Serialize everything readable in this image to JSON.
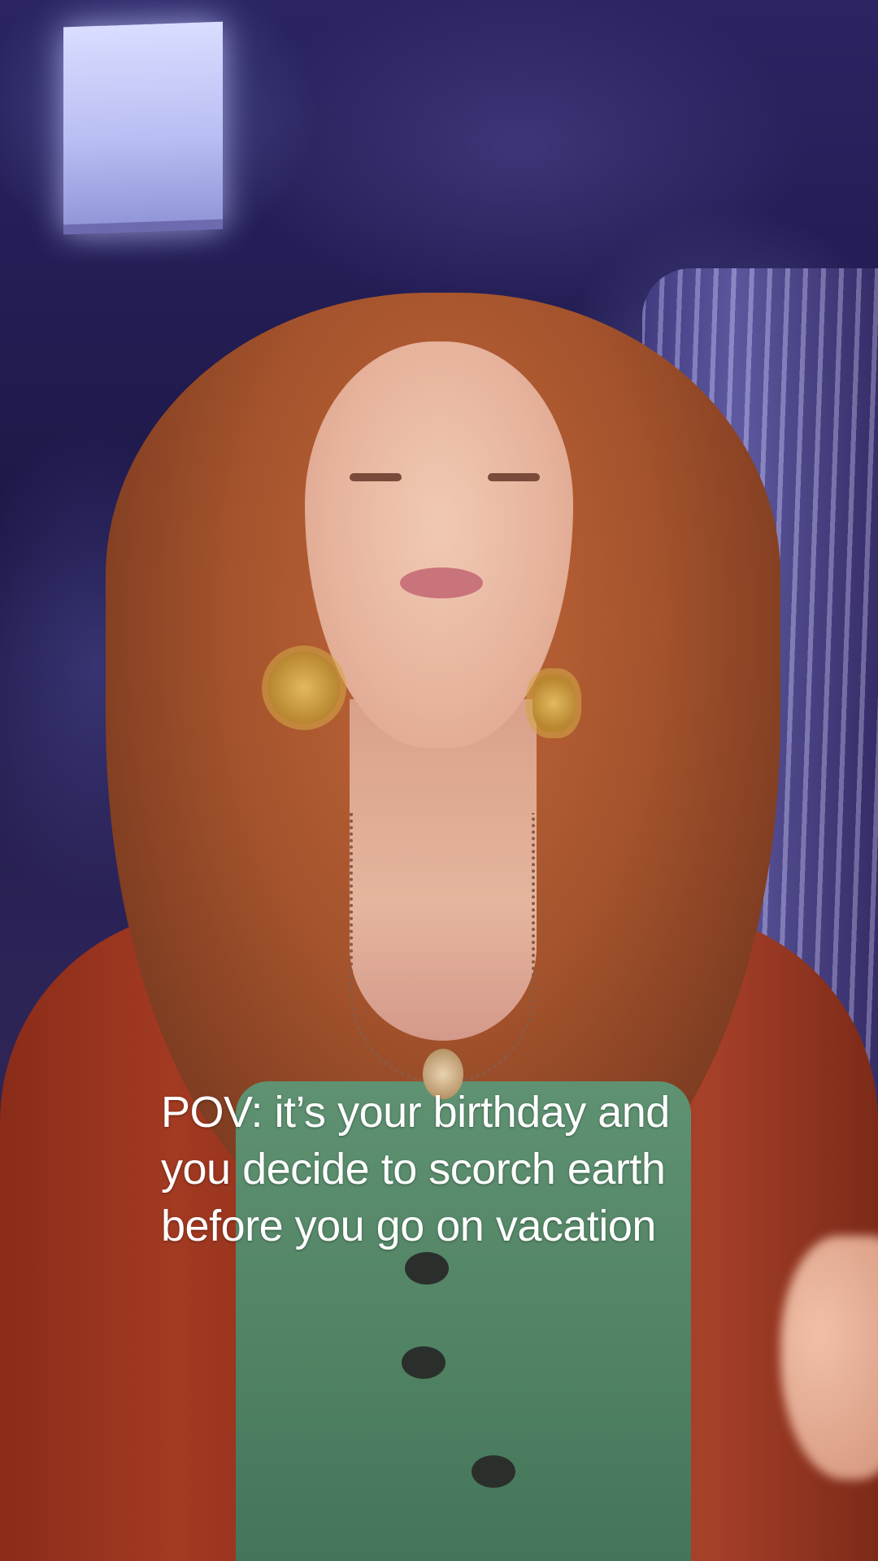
{
  "video": {
    "caption_lines": [
      "POV: it’s your birthday and",
      "you decide to scorch earth",
      "before you go on vacation"
    ]
  },
  "colors": {
    "caption_text": "#ffffff",
    "background_dominant": "#2a2463",
    "hair": "#b65a30",
    "jacket": "#9a3520",
    "shirt": "#558a69"
  }
}
